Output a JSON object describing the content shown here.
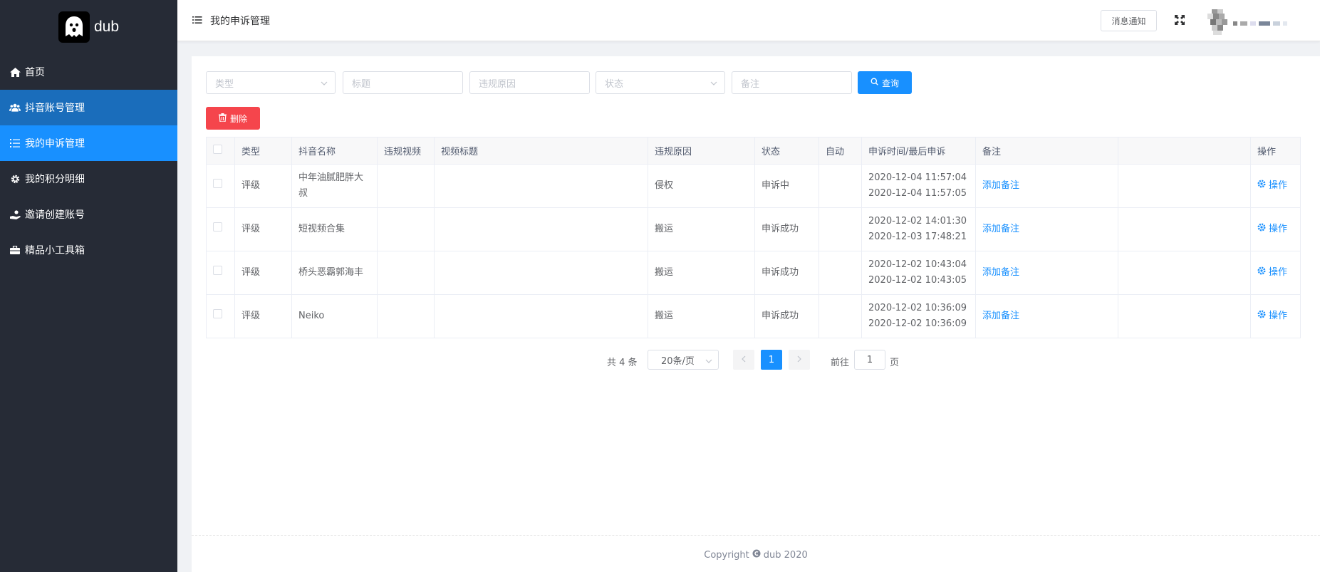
{
  "app": {
    "name": "dub"
  },
  "sidebar": {
    "items": [
      {
        "label": "首页",
        "icon": "home-icon"
      },
      {
        "label": "抖音账号管理",
        "icon": "users-icon"
      },
      {
        "label": "我的申诉管理",
        "icon": "list-icon"
      },
      {
        "label": "我的积分明细",
        "icon": "gear-icon"
      },
      {
        "label": "邀请创建账号",
        "icon": "hand-user-icon"
      },
      {
        "label": "精品小工具箱",
        "icon": "toolbox-icon"
      }
    ]
  },
  "header": {
    "title": "我的申诉管理",
    "notice_label": "消息通知"
  },
  "filters": {
    "type_placeholder": "类型",
    "title_placeholder": "标题",
    "reason_placeholder": "违规原因",
    "status_placeholder": "状态",
    "remark_placeholder": "备注",
    "query_label": "查询",
    "delete_label": "删除"
  },
  "table": {
    "columns": [
      "类型",
      "抖音名称",
      "违规视频",
      "视频标题",
      "违规原因",
      "状态",
      "自动",
      "申诉时间/最后申诉",
      "备注",
      "",
      "操作"
    ],
    "rows": [
      {
        "type": "评级",
        "name": "中年油腻肥胖大叔",
        "video": "",
        "video_title": "",
        "reason": "侵权",
        "status": "申诉中",
        "auto": "",
        "time1": "2020-12-04 11:57:04",
        "time2": "2020-12-04 11:57:05",
        "remark": "添加备注",
        "op": "操作"
      },
      {
        "type": "评级",
        "name": "短视频合集",
        "video": "",
        "video_title": "",
        "reason": "搬运",
        "status": "申诉成功",
        "auto": "",
        "time1": "2020-12-02 14:01:30",
        "time2": "2020-12-03 17:48:21",
        "remark": "添加备注",
        "op": "操作"
      },
      {
        "type": "评级",
        "name": "桥头恶霸郭海丰",
        "video": "",
        "video_title": "",
        "reason": "搬运",
        "status": "申诉成功",
        "auto": "",
        "time1": "2020-12-02 10:43:04",
        "time2": "2020-12-02 10:43:05",
        "remark": "添加备注",
        "op": "操作"
      },
      {
        "type": "评级",
        "name": "Neiko",
        "video": "",
        "video_title": "",
        "reason": "搬运",
        "status": "申诉成功",
        "auto": "",
        "time1": "2020-12-02 10:36:09",
        "time2": "2020-12-02 10:36:09",
        "remark": "添加备注",
        "op": "操作"
      }
    ]
  },
  "pagination": {
    "total": "共 4 条",
    "page_size": "20条/页",
    "current_page": "1",
    "goto_label": "前往",
    "goto_value": "1",
    "page_unit": "页"
  },
  "footer": {
    "copyright_prefix": "Copyright",
    "copyright_suffix": "dub 2020"
  },
  "colors": {
    "sidebar_bg": "#262b36",
    "active": "#1890ff",
    "danger": "#f5454c",
    "success": "#1aaa55"
  }
}
